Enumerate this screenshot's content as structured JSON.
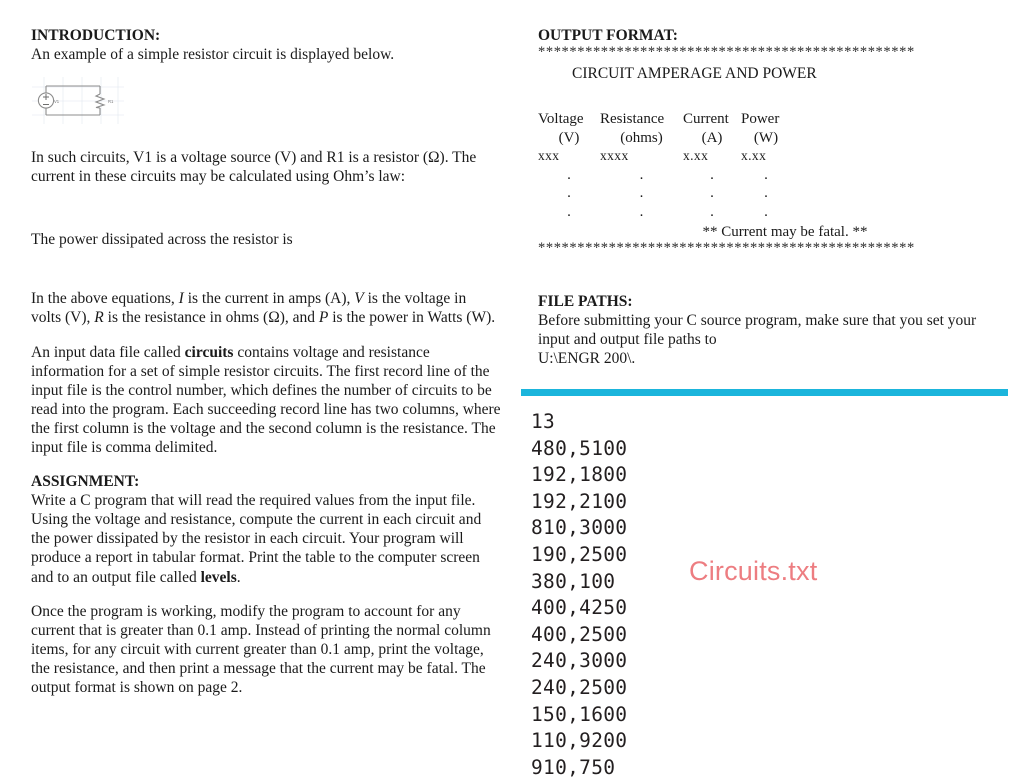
{
  "left_column": {
    "intro_heading": "INTRODUCTION:",
    "intro_line": "An example of a simple resistor circuit is displayed below.",
    "circuit": {
      "source_label": "V1",
      "resistor_label": "R1",
      "plus_sign": "+",
      "minus_sign": "−"
    },
    "ohms_law_para_a": "In such circuits, V1 is a voltage source (V) and R1 is a resistor (Ω). The",
    "ohms_law_para_b": "current in these circuits may be calculated using Ohm’s law:",
    "power_line": "The power dissipated across the resistor is",
    "variables_para_a_1": "In the above equations, ",
    "variables_para_a_i1": "I",
    "variables_para_a_2": " is the current in amps (A), ",
    "variables_para_a_i2": "V",
    "variables_para_a_3": " is the voltage in",
    "variables_para_b_1": "volts (V), ",
    "variables_para_b_i1": "R",
    "variables_para_b_2": " is the resistance in ohms (Ω), and ",
    "variables_para_b_i2": "P",
    "variables_para_b_3": " is the power in Watts (W).",
    "input_file_para_1": "An input data file called ",
    "input_file_bold": "circuits",
    "input_file_para_2": " contains voltage and resistance information for a set of simple resistor circuits.  The first record line of the input file is the control number, which defines the number of circuits to be read into the program.  Each succeeding record line has two columns, where the first column is the voltage and the second column is the resistance.  The input file is comma delimited.",
    "assignment_heading": "ASSIGNMENT:",
    "assignment_para_1": "Write a C program that will read the required values from the input file.  Using the voltage and resistance, compute the current in each circuit and the power dissipated by the resistor in each circuit.  Your program will produce a report in tabular format.  Print the table to the computer screen and to an output file called ",
    "assignment_bold": "levels",
    "assignment_para_2": ".",
    "modify_para": "Once the program is working, modify the program to account for any current that is greater than 0.1 amp.  Instead of printing the normal column items, for any circuit with current greater than 0.1 amp, print the voltage, the resistance, and then print a message that the current may be fatal.  The output format is shown on page 2."
  },
  "right_column": {
    "output_heading": "OUTPUT FORMAT:",
    "star_rule": "************************************************",
    "report_title": "CIRCUIT AMPERAGE AND POWER",
    "table": {
      "headers": [
        "Voltage",
        "Resistance",
        "Current",
        "Power"
      ],
      "units": [
        "(V)",
        "(ohms)",
        "(A)",
        "(W)"
      ],
      "placeholders": [
        "xxx",
        "xxxx",
        "x.xx",
        "x.xx"
      ],
      "dot": ".",
      "dot_row_count": 3
    },
    "fatal_note": "** Current may be fatal. **",
    "file_paths_heading": "FILE PATHS:",
    "file_paths_line1": "Before submitting your C source program, make sure that you set your",
    "file_paths_line2": "input and output file paths to",
    "file_paths_value": "U:\\ENGR 200\\."
  },
  "data_file": {
    "caption": "Circuits.txt",
    "lines": [
      "13",
      "480,5100",
      "192,1800",
      "192,2100",
      "810,3000",
      "190,2500",
      "380,100",
      "400,4250",
      "400,2500",
      "240,3000",
      "240,2500",
      "150,1600",
      "110,9200",
      "910,750"
    ]
  },
  "colors": {
    "divider": "#1BB5DC",
    "caption": "#ED7D81",
    "text": "#1a1a1a"
  }
}
